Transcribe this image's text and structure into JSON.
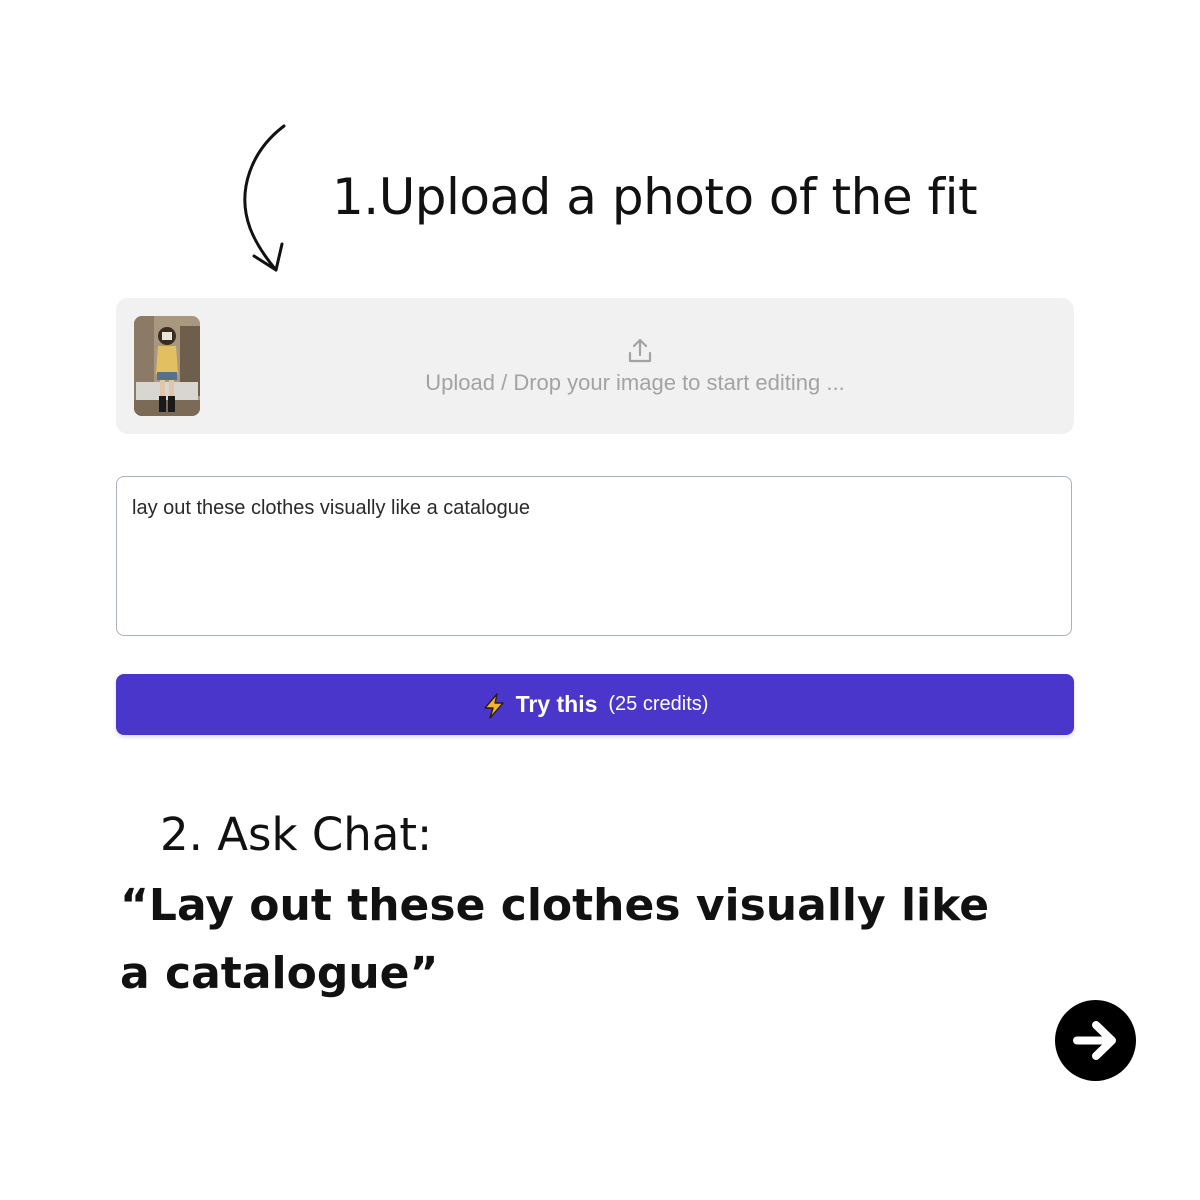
{
  "step1": {
    "title": "1.Upload a photo of the fit"
  },
  "upload": {
    "hint": "Upload / Drop your image to start editing ..."
  },
  "prompt": {
    "value": "lay out these clothes visually like a catalogue"
  },
  "button": {
    "label": "Try this",
    "credits": "(25 credits)",
    "icon": "lightning-bolt-icon",
    "color": "#4b36cc"
  },
  "step2": {
    "title": "2.  Ask Chat:",
    "prompt": "“Lay out these clothes visually like a catalogue”"
  },
  "navigation": {
    "next_icon": "arrow-right-circle-icon"
  }
}
